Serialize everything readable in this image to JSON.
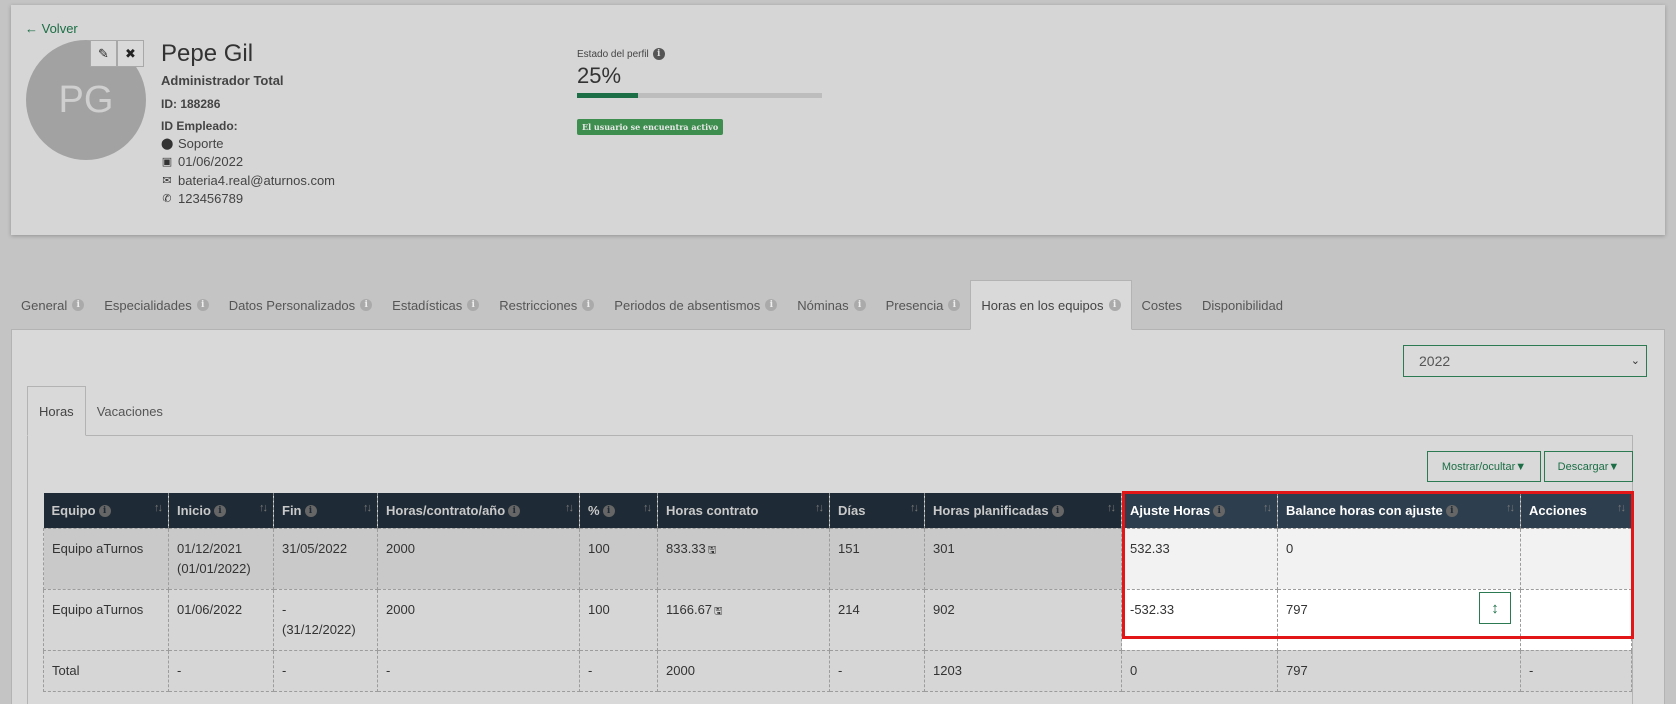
{
  "profile": {
    "back_label": "Volver",
    "initials": "PG",
    "name": "Pepe Gil",
    "role": "Administrador Total",
    "id_line": "ID: 188286",
    "employee_id_line": "ID Empleado:",
    "location": "Soporte",
    "date": "01/06/2022",
    "email": "bateria4.real@aturnos.com",
    "phone": "123456789",
    "state_label": "Estado del perfil",
    "completion": "25%",
    "completion_fraction": 0.25,
    "active_badge": "El usuario se encuentra activo"
  },
  "tabs": [
    {
      "label": "General",
      "info": true
    },
    {
      "label": "Especialidades",
      "info": true
    },
    {
      "label": "Datos Personalizados",
      "info": true
    },
    {
      "label": "Estadísticas",
      "info": true
    },
    {
      "label": "Restricciones",
      "info": true
    },
    {
      "label": "Periodos de absentismos",
      "info": true
    },
    {
      "label": "Nóminas",
      "info": true
    },
    {
      "label": "Presencia",
      "info": true
    },
    {
      "label": "Horas en los equipos",
      "info": true,
      "active": true
    },
    {
      "label": "Costes",
      "info": false
    },
    {
      "label": "Disponibilidad",
      "info": false
    }
  ],
  "year_select": {
    "value": "2022"
  },
  "subtabs": [
    {
      "label": "Horas",
      "active": true
    },
    {
      "label": "Vacaciones",
      "active": false
    }
  ],
  "toolbar": {
    "show_hide_label": "Mostrar/ocultar▼",
    "download_label": "Descargar▼"
  },
  "table": {
    "headers": [
      "Equipo",
      "Inicio",
      "Fin",
      "Horas/contrato/año",
      "%",
      "Horas contrato",
      "Días",
      "Horas planificadas",
      "Ajuste Horas",
      "Balance horas con ajuste",
      "Acciones"
    ],
    "header_info": [
      true,
      true,
      true,
      true,
      true,
      false,
      false,
      true,
      true,
      true,
      false
    ],
    "rows": [
      {
        "equipo": "Equipo aTurnos",
        "inicio": "01/12/2021",
        "inicio2": "(01/01/2022)",
        "fin": "31/05/2022",
        "fin2": "",
        "horas_contrato_anio": "2000",
        "pct": "100",
        "horas_contrato": "833.33",
        "dias": "151",
        "horas_planificadas": "301",
        "ajuste": "532.33",
        "balance": "0",
        "acciones": ""
      },
      {
        "equipo": "Equipo aTurnos",
        "inicio": "01/06/2022",
        "inicio2": "",
        "fin": "-",
        "fin2": "(31/12/2022)",
        "horas_contrato_anio": "2000",
        "pct": "100",
        "horas_contrato": "1166.67",
        "dias": "214",
        "horas_planificadas": "902",
        "ajuste": "-532.33",
        "balance": "797",
        "acciones": ""
      }
    ],
    "total": {
      "equipo": "Total",
      "inicio": "-",
      "fin": "-",
      "horas_contrato_anio": "-",
      "pct": "-",
      "horas_contrato": "2000",
      "dias": "-",
      "horas_planificadas": "1203",
      "ajuste": "0",
      "balance": "797",
      "acciones": "-"
    }
  }
}
